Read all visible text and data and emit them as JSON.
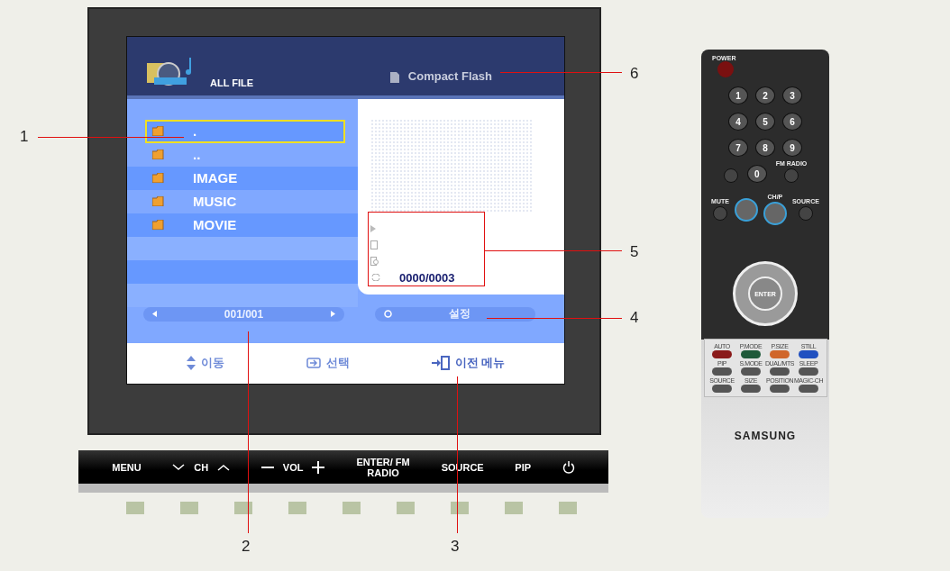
{
  "screen": {
    "title": "ALL FILE",
    "device": "Compact Flash",
    "files": [
      {
        "name": ".",
        "selected": true
      },
      {
        "name": "..",
        "selected": false
      },
      {
        "name": "IMAGE",
        "selected": false
      },
      {
        "name": "MUSIC",
        "selected": false
      },
      {
        "name": "MOVIE",
        "selected": false
      }
    ],
    "counter": "0000/0003",
    "page": "001/001",
    "settings": "설정",
    "footer": [
      {
        "kind": "move",
        "label": "이동"
      },
      {
        "kind": "select",
        "label": "선택"
      },
      {
        "kind": "back",
        "label": "이전 메뉴"
      }
    ]
  },
  "panel_buttons": [
    {
      "kind": "text",
      "label": "MENU"
    },
    {
      "kind": "updown",
      "label": "CH"
    },
    {
      "kind": "plusminus",
      "label": "VOL"
    },
    {
      "kind": "text",
      "label": "ENTER/ FM RADIO"
    },
    {
      "kind": "text",
      "label": "SOURCE"
    },
    {
      "kind": "text",
      "label": "PIP"
    },
    {
      "kind": "power"
    }
  ],
  "callouts": [
    "6",
    "1",
    "5",
    "4",
    "2",
    "3"
  ],
  "remote": {
    "power": "POWER",
    "digits": [
      "1",
      "2",
      "3",
      "4",
      "5",
      "6",
      "7",
      "8",
      "9"
    ],
    "zero": "0",
    "fm_radio": "FM RADIO",
    "mute": "MUTE",
    "channel": "CH/P",
    "source": "SOURCE",
    "enter": "ENTER",
    "color_keys": [
      {
        "label": "AUTO",
        "color": "#8a1a1a"
      },
      {
        "label": "P.MODE",
        "color": "#1f5a3a"
      },
      {
        "label": "P.SIZE",
        "color": "#d0662a"
      },
      {
        "label": "STILL",
        "color": "#2050c0"
      }
    ],
    "function_keys": [
      "PIP",
      "S.MODE",
      "DUAL/MTS",
      "SLEEP",
      "SOURCE",
      "SIZE",
      "POSITION",
      "MAGIC-CH"
    ],
    "brand": "SAMSUNG"
  }
}
